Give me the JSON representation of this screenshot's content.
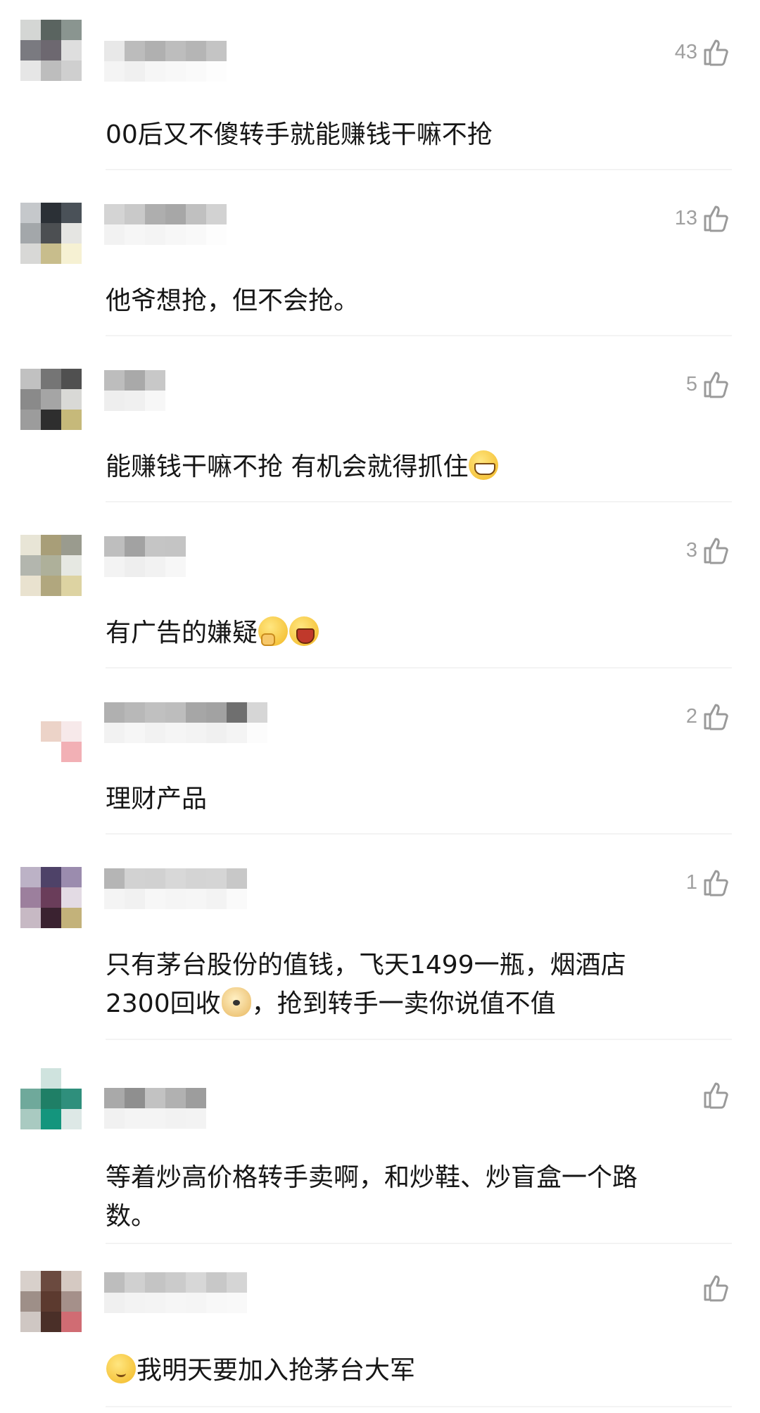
{
  "comments": [
    {
      "likes": "43",
      "text": "00后又不傻转手就能赚钱干嘛不抢",
      "emojis": []
    },
    {
      "likes": "13",
      "text": "他爷想抢，但不会抢。",
      "emojis": []
    },
    {
      "likes": "5",
      "text": "能赚钱干嘛不抢 有机会就得抓住",
      "emojis": [
        "grinning-emoji"
      ]
    },
    {
      "likes": "3",
      "text": "有广告的嫌疑",
      "emojis": [
        "thinking-emoji",
        "laughing-emoji"
      ]
    },
    {
      "likes": "2",
      "text": "理财产品",
      "emojis": []
    },
    {
      "likes": "1",
      "text_line1": "只有茅台股份的值钱，飞天1499一瓶，烟酒店",
      "text_line2_a": "2300回收",
      "text_line2_b": "，抢到转手一卖你说值不值",
      "emojis": [
        "doge-emoji"
      ]
    },
    {
      "likes": "",
      "text_line1": "等着炒高价格转手卖啊，和炒鞋、炒盲盒一个路",
      "text_line2": "数。",
      "emojis": []
    },
    {
      "likes": "",
      "text": "我明天要加入抢茅台大军",
      "emojis": [
        "shy-emoji"
      ]
    }
  ],
  "icons": {
    "like": "thumbs-up-outline-icon"
  },
  "colors": {
    "like_gray": "#a0a0a0",
    "text": "#161616",
    "divider": "#f3f3f3"
  }
}
